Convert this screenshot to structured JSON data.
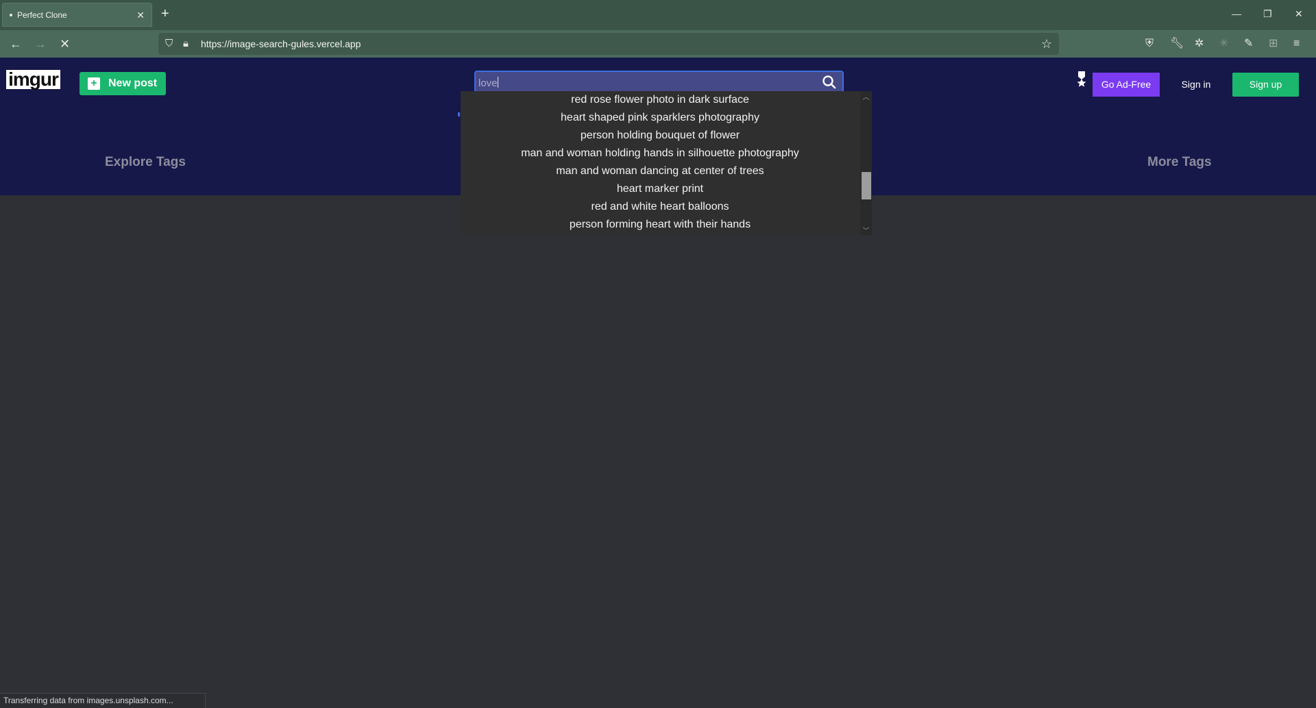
{
  "browser": {
    "tab_title": "Perfect Clone",
    "url": "https://image-search-gules.vercel.app",
    "status_text": "Transferring data from images.unsplash.com..."
  },
  "header": {
    "logo_text": "imgur",
    "new_post_label": "New post",
    "search": {
      "value": "love"
    },
    "go_adfree_label": "Go Ad-Free",
    "sign_in_label": "Sign in",
    "sign_up_label": "Sign up",
    "explore_tags_label": "Explore Tags",
    "more_tags_label": "More Tags"
  },
  "suggestions": [
    "red rose flower photo in dark surface",
    "heart shaped pink sparklers photography",
    "person holding bouquet of flower",
    "man and woman holding hands in silhouette photography",
    "man and woman dancing at center of trees",
    "heart marker print",
    "red and white heart balloons",
    "person forming heart with their hands"
  ],
  "colors": {
    "header_bg": "#161849",
    "page_bg": "#2e3035",
    "accent_green": "#1bb76e",
    "accent_purple": "#7b3bf0",
    "browser_chrome": "#4c6a5c"
  }
}
